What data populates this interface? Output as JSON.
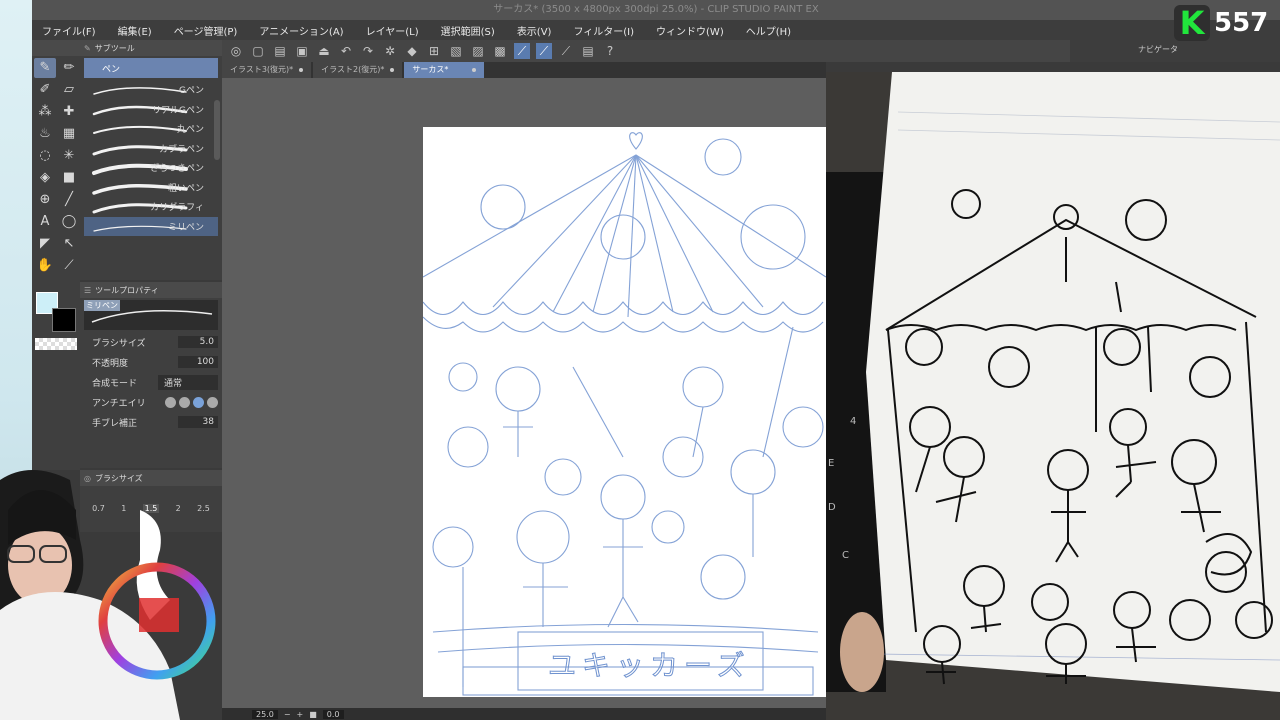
{
  "window": {
    "title": "サーカス* (3500 x 4800px 300dpi 25.0%)  - CLIP STUDIO PAINT EX"
  },
  "menu": [
    "ファイル(F)",
    "編集(E)",
    "ページ管理(P)",
    "アニメーション(A)",
    "レイヤー(L)",
    "選択範囲(S)",
    "表示(V)",
    "フィルター(I)",
    "ウィンドウ(W)",
    "ヘルプ(H)"
  ],
  "tabs": [
    {
      "label": "イラスト3(復元)*",
      "active": false
    },
    {
      "label": "イラスト2(復元)*",
      "active": false
    },
    {
      "label": "サーカス*",
      "active": true
    }
  ],
  "subtool": {
    "title": "サブツール",
    "group": "ペン",
    "brushes": [
      "Gペン",
      "リアルGペン",
      "丸ペン",
      "カブラペン",
      "ざらつきペン",
      "粗いペン",
      "カリグラフィ",
      "ミリペン"
    ],
    "selected_index": 7
  },
  "toolprop": {
    "title": "ツールプロパティ",
    "brush_name": "ミリペン",
    "size_label": "ブラシサイズ",
    "size_value": "5.0",
    "opacity_label": "不透明度",
    "opacity_value": "100",
    "blend_label": "合成モード",
    "blend_value": "通常",
    "aa_label": "アンチエイリ",
    "stabilize_label": "手ブレ補正",
    "stabilize_value": "38"
  },
  "brushsize": {
    "title": "ブラシサイズ",
    "sizes": [
      "0.7",
      "1",
      "1.5",
      "2",
      "2.5"
    ],
    "selected": "1.5"
  },
  "colors": {
    "main": "#cdeff8",
    "sub": "#000000",
    "accent": "#6b84b0"
  },
  "navigator": {
    "title": "ナビゲータ"
  },
  "status": {
    "zoom": "25.0",
    "rotation": "0.0"
  },
  "logo": {
    "letter": "K",
    "number": "557"
  },
  "canvas": {
    "banner_text": "ユキッカーズ"
  },
  "keyboard_keys": [
    "4",
    "E",
    "D",
    "C"
  ]
}
